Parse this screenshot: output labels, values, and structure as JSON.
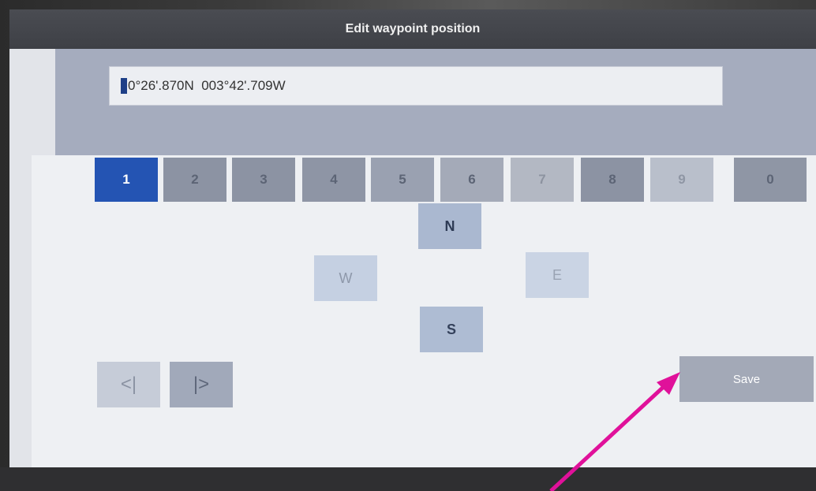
{
  "dialog": {
    "title": "Edit waypoint position",
    "coordinate_value": "0°26'.870N  003°42'.709W"
  },
  "keypad": {
    "digits": [
      {
        "label": "1",
        "active": true
      },
      {
        "label": "2"
      },
      {
        "label": "3"
      },
      {
        "label": "4"
      },
      {
        "label": "5"
      },
      {
        "label": "6"
      },
      {
        "label": "7"
      },
      {
        "label": "8"
      },
      {
        "label": "9"
      },
      {
        "label": "0"
      }
    ]
  },
  "directions": {
    "north": "N",
    "west": "W",
    "east": "E",
    "south": "S"
  },
  "cursor_nav": {
    "left": "<|",
    "right": "|>"
  },
  "actions": {
    "save": "Save"
  },
  "colors": {
    "active_key": "#2454b3",
    "annotation_arrow": "#e0119a"
  }
}
